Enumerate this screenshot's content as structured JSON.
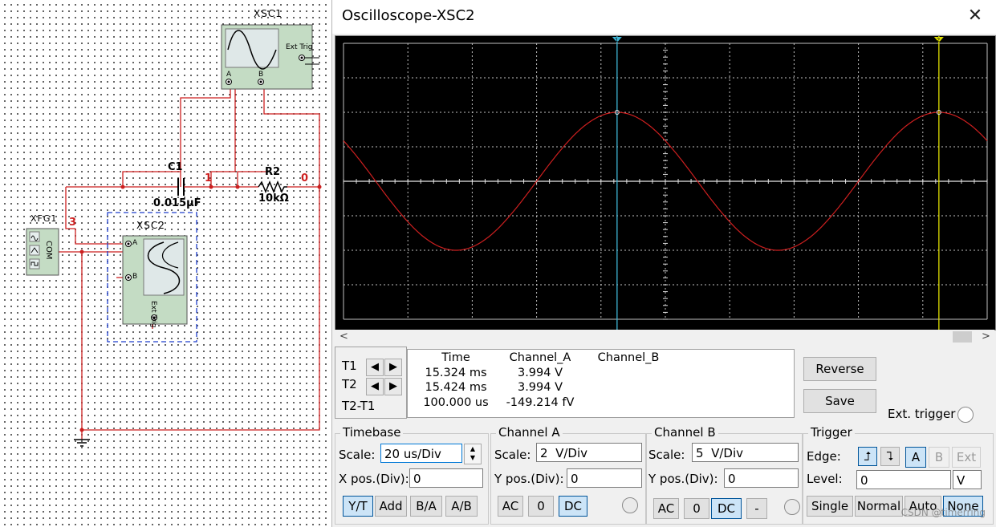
{
  "schematic": {
    "xsc1_label": "XSC1",
    "xsc1_ext_trig": "Ext Trig",
    "xsc1_pin_a": "A",
    "xsc1_pin_b": "B",
    "xsc2_label": "XSC2",
    "xsc2_ext_trig": "Ext Trig",
    "xsc2_pin_a": "A",
    "xsc2_pin_b": "B",
    "xfg1_label": "XFG1",
    "xfg1_com": "COM",
    "c1_name": "C1",
    "c1_value": "0.015µF",
    "r2_name": "R2",
    "r2_value": "10kΩ",
    "node_1": "1",
    "node_0": "0",
    "node_3": "3",
    "wire_color": "#cc1f1f",
    "selection_color": "#1f3fcc"
  },
  "window": {
    "title": "Oscilloscope-XSC2",
    "close_icon": "close-icon"
  },
  "scope_screen": {
    "background": "#000000",
    "grid_color": "#bfbfbf",
    "trace_color": "#cc1f1f",
    "cursor1_color": "#3fb6d6",
    "cursor2_color": "#e0e000",
    "cursor1_label": "1",
    "cursor2_label": "2"
  },
  "chart_data": {
    "type": "line",
    "timebase": "20 us/Div",
    "channel_a_scale": "2 V/Div",
    "ylim_div": [
      -4,
      4
    ],
    "xlim_div": [
      0,
      10
    ],
    "series": [
      {
        "color": "#cc1f1f",
        "amplitude_div": 2,
        "period_div": 5,
        "peaks_div": [
          4.25,
          9.25
        ],
        "troughs_div": [
          1.75,
          6.75
        ]
      }
    ],
    "cursor_1_div": 4.25,
    "cursor_2_div": 9.25
  },
  "readout": {
    "t1": "T1",
    "t2": "T2",
    "t2_t1": "T2-T1",
    "header_time": "Time",
    "header_a": "Channel_A",
    "header_b": "Channel_B",
    "rows": [
      {
        "time": "15.324 ms",
        "a": "3.994 V",
        "b": ""
      },
      {
        "time": "15.424 ms",
        "a": "3.994 V",
        "b": ""
      },
      {
        "time": "100.000 us",
        "a": "-149.214 fV",
        "b": ""
      }
    ]
  },
  "buttons": {
    "reverse": "Reverse",
    "save": "Save",
    "ext_trigger": "Ext. trigger"
  },
  "timebase": {
    "title": "Timebase",
    "scale_label": "Scale:",
    "scale_value": "20 us/Div",
    "xpos_label": "X pos.(Div):",
    "xpos_value": "0",
    "modes": [
      "Y/T",
      "Add",
      "B/A",
      "A/B"
    ],
    "active_mode": "Y/T"
  },
  "channel_a": {
    "title": "Channel A",
    "scale_label": "Scale:",
    "scale_value": "2  V/Div",
    "ypos_label": "Y pos.(Div):",
    "ypos_value": "0",
    "coupling": [
      "AC",
      "0",
      "DC"
    ],
    "active": "DC"
  },
  "channel_b": {
    "title": "Channel B",
    "scale_label": "Scale:",
    "scale_value": "5  V/Div",
    "ypos_label": "Y pos.(Div):",
    "ypos_value": "0",
    "coupling": [
      "AC",
      "0",
      "DC",
      "-"
    ],
    "active": "DC"
  },
  "trigger": {
    "title": "Trigger",
    "edge_label": "Edge:",
    "sources": [
      "A",
      "B",
      "Ext"
    ],
    "active_source": "A",
    "level_label": "Level:",
    "level_value": "0",
    "level_unit": "V",
    "modes": [
      "Single",
      "Normal",
      "Auto",
      "None"
    ],
    "active_mode": "None"
  },
  "watermark": "CSDN @timerring"
}
